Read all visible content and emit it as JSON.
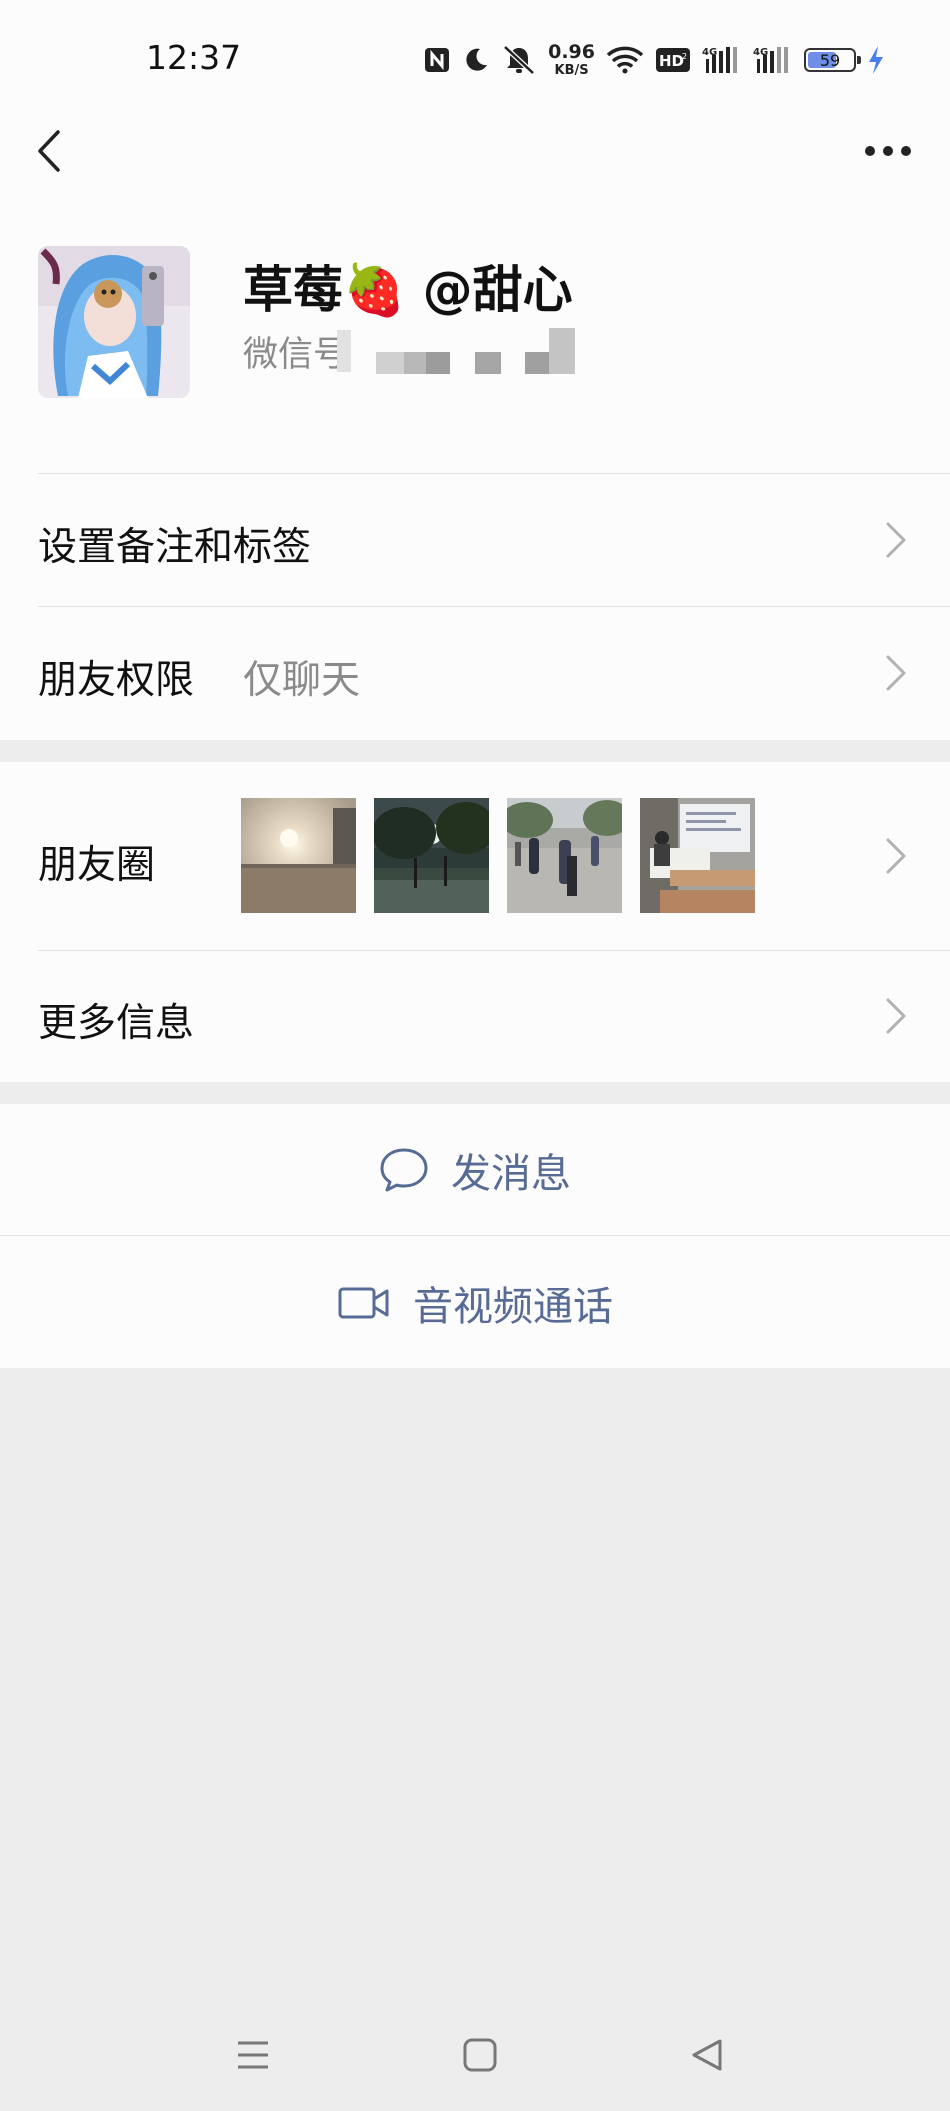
{
  "status_bar": {
    "time": "12:37",
    "net_speed_value": "0.96",
    "net_speed_unit": "KB/S",
    "battery_level": "59",
    "icons": [
      "nfc-icon",
      "moon-icon",
      "mute-icon",
      "wifi-icon",
      "hd-icon",
      "signal-4g-icon",
      "signal-4g-icon",
      "battery-icon",
      "charging-bolt-icon"
    ]
  },
  "nav": {
    "back_icon": "chevron-left-icon",
    "more_icon": "more-dots-icon"
  },
  "profile": {
    "nickname": "草莓🍓 @甜心",
    "wechat_id_label": "微信号"
  },
  "rows": {
    "remark_tags": "设置备注和标签",
    "friend_permission_label": "朋友权限",
    "friend_permission_value": "仅聊天",
    "moments_label": "朋友圈",
    "more_info": "更多信息"
  },
  "actions": {
    "send_message": "发消息",
    "video_call": "音视频通话"
  },
  "colors": {
    "link_blue": "#576b95",
    "page_bg": "#ededed",
    "card_bg": "#fcfcfc",
    "secondary_text": "#8a8a8a"
  },
  "system_nav": {
    "icons": [
      "menu-icon",
      "home-square-icon",
      "back-triangle-icon"
    ]
  }
}
